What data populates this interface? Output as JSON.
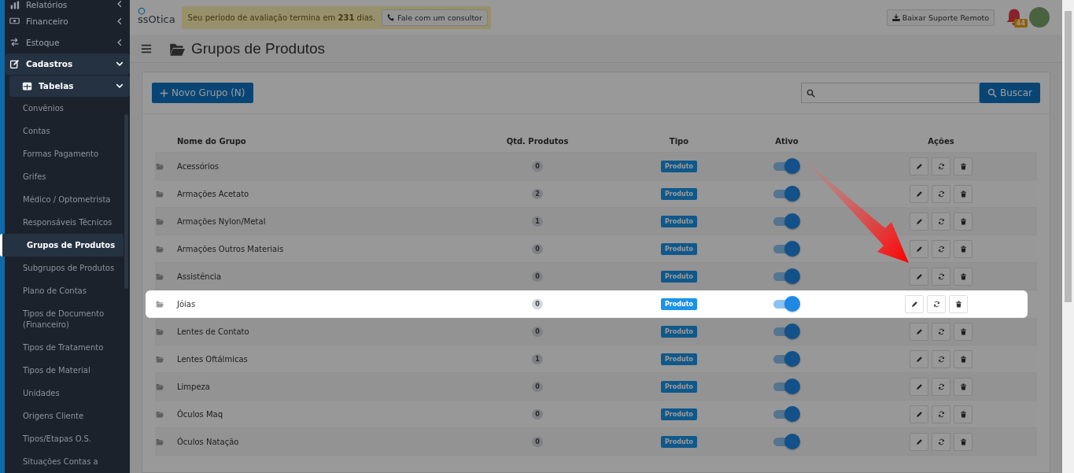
{
  "sidebar": {
    "items": [
      {
        "label": "Relatórios",
        "kind": "section",
        "expanded": false
      },
      {
        "label": "Financeiro",
        "kind": "section",
        "expanded": false
      },
      {
        "label": "Estoque",
        "kind": "section",
        "expanded": false
      },
      {
        "label": "Cadastros",
        "kind": "section",
        "expanded": true
      },
      {
        "label": "Tabelas",
        "kind": "subsection",
        "expanded": true
      },
      {
        "label": "Convênios",
        "kind": "link",
        "selected": false
      },
      {
        "label": "Contas",
        "kind": "link",
        "selected": false
      },
      {
        "label": "Formas Pagamento",
        "kind": "link",
        "selected": false
      },
      {
        "label": "Grifes",
        "kind": "link",
        "selected": false
      },
      {
        "label": "Médico / Optometrista",
        "kind": "link",
        "selected": false
      },
      {
        "label": "Responsáveis Técnicos",
        "kind": "link",
        "selected": false
      },
      {
        "label": "Grupos de Produtos",
        "kind": "link",
        "selected": true
      },
      {
        "label": "Subgrupos de Produtos",
        "kind": "link",
        "selected": false
      },
      {
        "label": "Plano de Contas",
        "kind": "link",
        "selected": false
      },
      {
        "label": "Tipos de Documento (Financeiro)",
        "kind": "link",
        "selected": false
      },
      {
        "label": "Tipos de Tratamento",
        "kind": "link",
        "selected": false
      },
      {
        "label": "Tipos de Material",
        "kind": "link",
        "selected": false
      },
      {
        "label": "Unidades",
        "kind": "link",
        "selected": false
      },
      {
        "label": "Origens Cliente",
        "kind": "link",
        "selected": false
      },
      {
        "label": "Tipos/Etapas O.S.",
        "kind": "link",
        "selected": false
      },
      {
        "label": "Situações Contas a",
        "kind": "link",
        "selected": false
      }
    ]
  },
  "topbar": {
    "logo": "ssOtica",
    "trial_notice": "Seu período de avaliação termina em **231** dias.",
    "consultant_button": "Fale com um consultor",
    "remote_support_button": "Baixar Suporte Remoto",
    "notification_count": "44"
  },
  "page": {
    "title": "Grupos de Produtos",
    "new_button": "Novo Grupo (N)",
    "search_button": "Buscar"
  },
  "table": {
    "columns": [
      "Nome do Grupo",
      "Qtd. Produtos",
      "Tipo",
      "Ativo",
      "Ações"
    ],
    "rows": [
      {
        "name": "Acessórios",
        "count": "0",
        "type": "Produto",
        "active": true,
        "highlighted": false
      },
      {
        "name": "Armações Acetato",
        "count": "2",
        "type": "Produto",
        "active": true,
        "highlighted": false
      },
      {
        "name": "Armações Nylon/Metal",
        "count": "1",
        "type": "Produto",
        "active": true,
        "highlighted": false
      },
      {
        "name": "Armações Outros Materiais",
        "count": "0",
        "type": "Produto",
        "active": true,
        "highlighted": false
      },
      {
        "name": "Assistência",
        "count": "0",
        "type": "Produto",
        "active": true,
        "highlighted": false
      },
      {
        "name": "Jóias",
        "count": "0",
        "type": "Produto",
        "active": true,
        "highlighted": true
      },
      {
        "name": "Lentes de Contato",
        "count": "0",
        "type": "Produto",
        "active": true,
        "highlighted": false
      },
      {
        "name": "Lentes Oftálmicas",
        "count": "1",
        "type": "Produto",
        "active": true,
        "highlighted": false
      },
      {
        "name": "Limpeza",
        "count": "0",
        "type": "Produto",
        "active": true,
        "highlighted": false
      },
      {
        "name": "Óculos Maq",
        "count": "0",
        "type": "Produto",
        "active": true,
        "highlighted": false
      },
      {
        "name": "Óculos Natação",
        "count": "0",
        "type": "Produto",
        "active": true,
        "highlighted": false
      }
    ]
  }
}
